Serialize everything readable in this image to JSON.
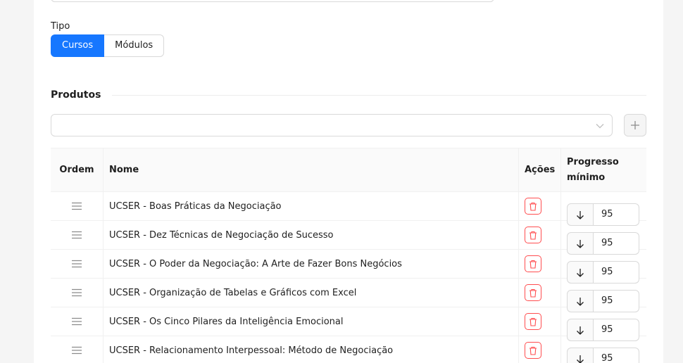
{
  "form": {
    "tipo_label": "Tipo",
    "tipo_options": [
      "Cursos",
      "Módulos"
    ],
    "tipo_selected": "Cursos"
  },
  "produtos": {
    "section_title": "Produtos",
    "select_value": "",
    "add_icon": "plus-icon"
  },
  "table": {
    "headers": {
      "ordem": "Ordem",
      "nome": "Nome",
      "acoes": "Ações",
      "progresso": "Progresso mínimo"
    },
    "rows": [
      {
        "nome": "UCSER - Boas Práticas da Negociação",
        "progresso": "95"
      },
      {
        "nome": "UCSER - Dez Técnicas de Negociação de Sucesso",
        "progresso": "95"
      },
      {
        "nome": "UCSER - O Poder da Negociação: A Arte de Fazer Bons Negócios",
        "progresso": "95"
      },
      {
        "nome": "UCSER - Organização de Tabelas e Gráficos com Excel",
        "progresso": "95"
      },
      {
        "nome": "UCSER - Os Cinco Pilares da Inteligência Emocional",
        "progresso": "95"
      },
      {
        "nome": "UCSER - Relacionamento Interpessoal: Método de Negociação",
        "progresso": "95"
      }
    ],
    "row_icons": {
      "drag": "drag-handle-icon",
      "delete": "trash-icon",
      "step": "arrow-down-icon"
    }
  },
  "colors": {
    "primary": "#1677ff",
    "danger": "#ff4d4f"
  }
}
